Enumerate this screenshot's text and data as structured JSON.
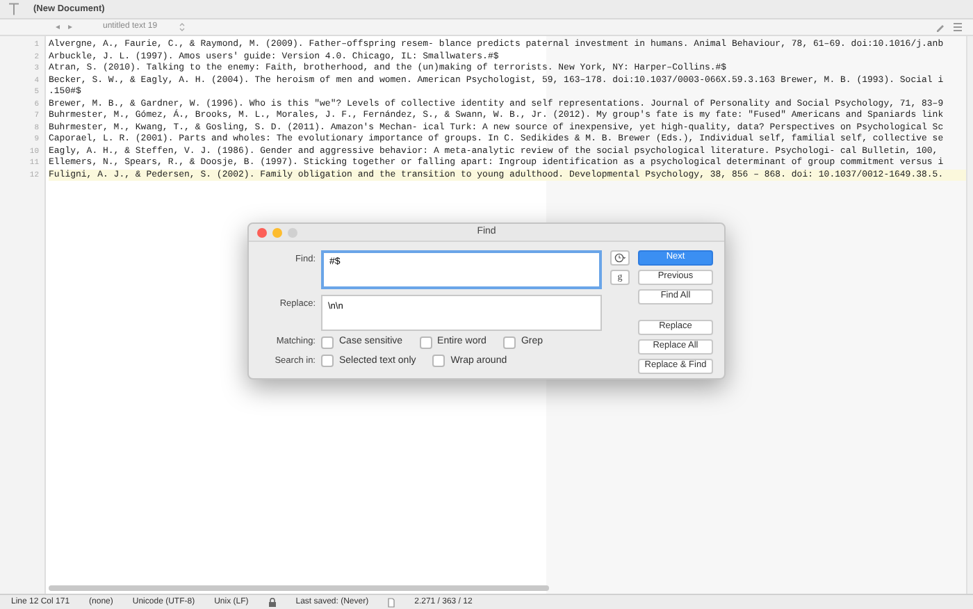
{
  "window": {
    "title": "(New Document)"
  },
  "tab": {
    "label": "untitled text 19",
    "nav_back": "◂",
    "nav_forward": "▸"
  },
  "editor": {
    "lines": [
      {
        "number": "1",
        "text": "Alvergne, A., Faurie, C., & Raymond, M. (2009). Father–offspring resem- blance predicts paternal investment in humans. Animal Behaviour, 78, 61–69. doi:10.1016/j.anb"
      },
      {
        "number": "2",
        "text": "Arbuckle, J. L. (1997). Amos users' guide: Version 4.0. Chicago, IL: Smallwaters.#$"
      },
      {
        "number": "3",
        "text": "Atran, S. (2010). Talking to the enemy: Faith, brotherhood, and the (un)making of terrorists. New York, NY: Harper–Collins.#$"
      },
      {
        "number": "4",
        "text": "Becker, S. W., & Eagly, A. H. (2004). The heroism of men and women. American Psychologist, 59, 163–178. doi:10.1037/0003-066X.59.3.163 Brewer, M. B. (1993). Social i"
      },
      {
        "number": "5",
        "text": ".150#$"
      },
      {
        "number": "6",
        "text": "Brewer, M. B., & Gardner, W. (1996). Who is this \"we\"? Levels of collective identity and self representations. Journal of Personality and Social Psychology, 71, 83–9"
      },
      {
        "number": "7",
        "text": "Buhrmester, M., Gómez, Á., Brooks, M. L., Morales, J. F., Fernández, S., & Swann, W. B., Jr. (2012). My group's fate is my fate: \"Fused\" Americans and Spaniards link"
      },
      {
        "number": "8",
        "text": "Buhrmester, M., Kwang, T., & Gosling, S. D. (2011). Amazon's Mechan- ical Turk: A new source of inexpensive, yet high-quality, data? Perspectives on Psychological Sc"
      },
      {
        "number": "9",
        "text": "Caporael, L. R. (2001). Parts and wholes: The evolutionary importance of groups. In C. Sedikides & M. B. Brewer (Eds.), Individual self, familial self, collective se"
      },
      {
        "number": "10",
        "text": "Eagly, A. H., & Steffen, V. J. (1986). Gender and aggressive behavior: A meta-analytic review of the social psychological literature. Psychologi- cal Bulletin, 100,"
      },
      {
        "number": "11",
        "text": "Ellemers, N., Spears, R., & Doosje, B. (1997). Sticking together or falling apart: Ingroup identification as a psychological determinant of group commitment versus i"
      },
      {
        "number": "12",
        "current": true,
        "text": "Fuligni, A. J., & Pedersen, S. (2002). Family obligation and the transition to young adulthood. Developmental Psychology, 38, 856 – 868. doi: 10.1037/0012-1649.38.5."
      }
    ]
  },
  "find_dialog": {
    "title": "Find",
    "find_label": "Find:",
    "find_value": "#$",
    "replace_label": "Replace:",
    "replace_value": "\\n\\n",
    "grep_menu": "g",
    "buttons": [
      {
        "label": "Next",
        "default": true
      },
      {
        "label": "Previous",
        "default": false
      },
      {
        "label": "Find All",
        "default": false
      },
      {
        "label": "Replace",
        "default": false
      },
      {
        "label": "Replace All",
        "default": false
      },
      {
        "label": "Replace & Find",
        "default": false
      }
    ],
    "option_rows": [
      {
        "label": "Matching:",
        "options": [
          {
            "label": "Case sensitive",
            "checked": false
          },
          {
            "label": "Entire word",
            "checked": false
          },
          {
            "label": "Grep",
            "checked": false
          }
        ]
      },
      {
        "label": "Search in:",
        "options": [
          {
            "label": "Selected text only",
            "checked": false
          },
          {
            "label": "Wrap around",
            "checked": false
          }
        ]
      }
    ]
  },
  "status_bar": {
    "position": "Line 12 Col 171",
    "language": "(none)",
    "encoding": "Unicode (UTF-8)",
    "line_endings": "Unix (LF)",
    "saved": "Last saved: (Never)",
    "counts": "2.271 / 363 / 12"
  }
}
